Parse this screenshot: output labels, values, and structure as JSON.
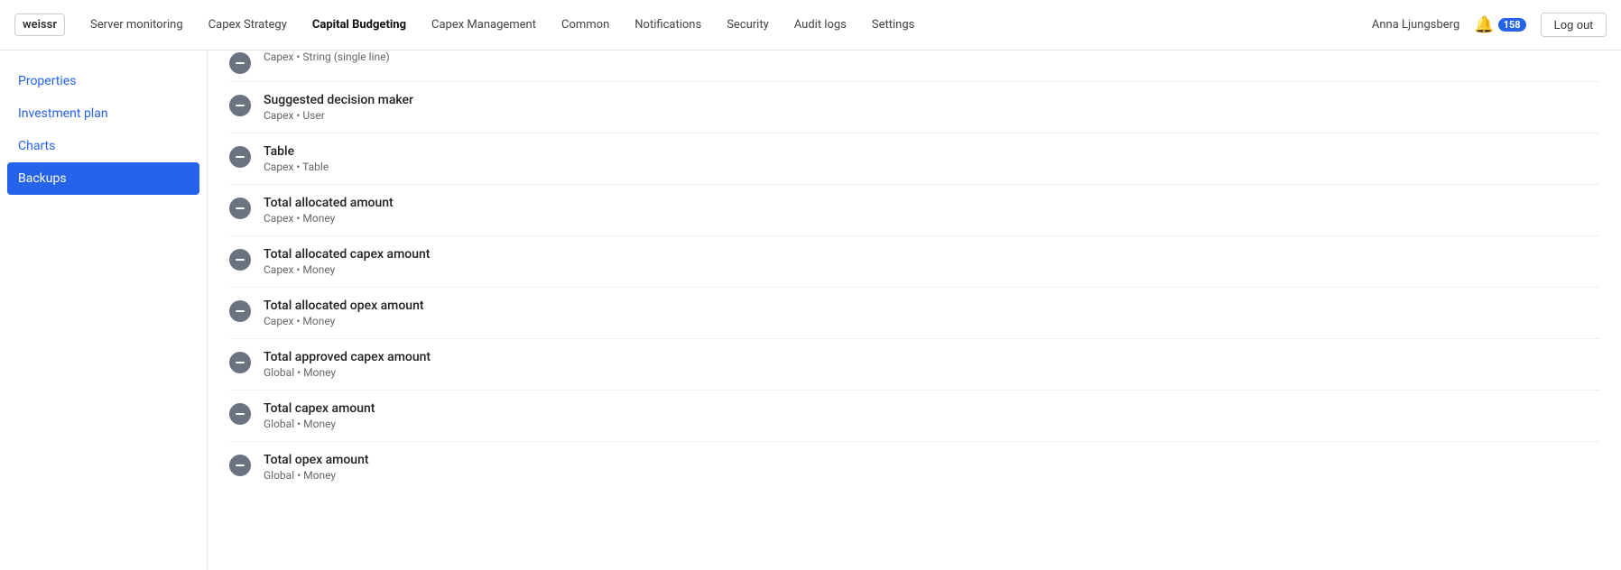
{
  "logo": "weissr",
  "nav": {
    "items": [
      {
        "label": "Server monitoring",
        "active": false
      },
      {
        "label": "Capex Strategy",
        "active": false
      },
      {
        "label": "Capital Budgeting",
        "active": true
      },
      {
        "label": "Capex Management",
        "active": false
      },
      {
        "label": "Common",
        "active": false
      },
      {
        "label": "Notifications",
        "active": false
      },
      {
        "label": "Security",
        "active": false
      },
      {
        "label": "Audit logs",
        "active": false
      },
      {
        "label": "Settings",
        "active": false
      }
    ],
    "user": "Anna Ljungsberg",
    "bell_count": "158",
    "logout_label": "Log out"
  },
  "sidebar": {
    "items": [
      {
        "label": "Properties",
        "active": false
      },
      {
        "label": "Investment plan",
        "active": false
      },
      {
        "label": "Charts",
        "active": false
      },
      {
        "label": "Backups",
        "active": true
      }
    ]
  },
  "list": {
    "partial_item": {
      "title": "Capex • String (single line)"
    },
    "items": [
      {
        "title": "Suggested decision maker",
        "subtitle": "Capex • User"
      },
      {
        "title": "Table",
        "subtitle": "Capex • Table"
      },
      {
        "title": "Total allocated amount",
        "subtitle": "Capex • Money"
      },
      {
        "title": "Total allocated capex amount",
        "subtitle": "Capex • Money"
      },
      {
        "title": "Total allocated opex amount",
        "subtitle": "Capex • Money"
      },
      {
        "title": "Total approved capex amount",
        "subtitle": "Global • Money"
      },
      {
        "title": "Total capex amount",
        "subtitle": "Global • Money"
      },
      {
        "title": "Total opex amount",
        "subtitle": "Global • Money"
      }
    ]
  }
}
